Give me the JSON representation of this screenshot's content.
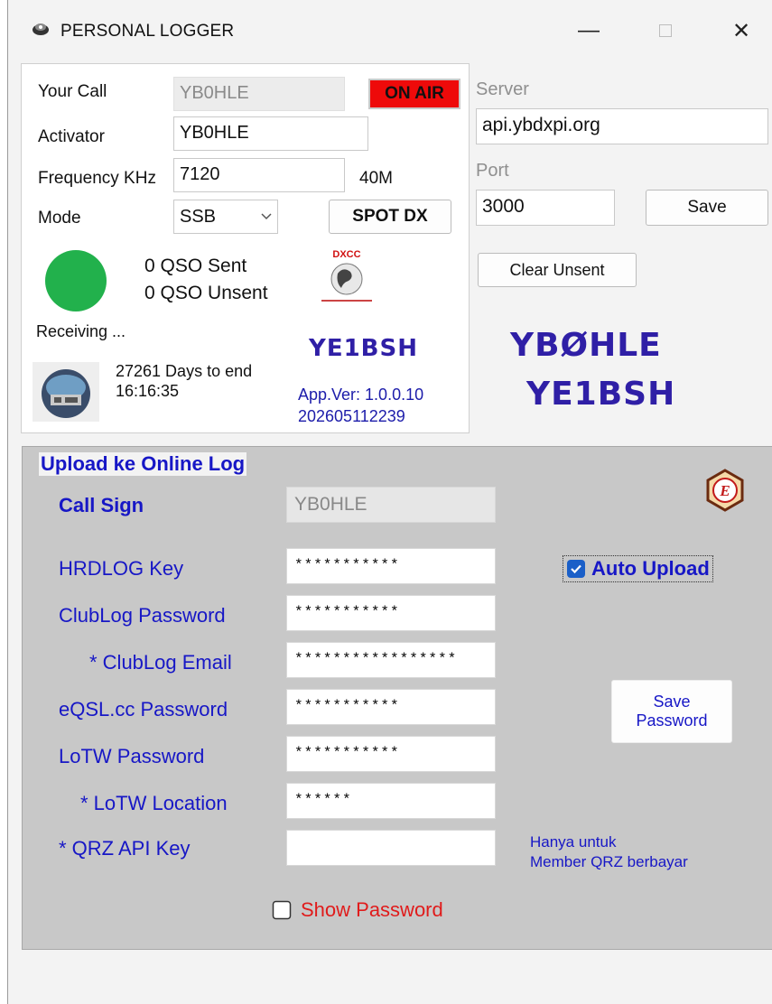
{
  "window": {
    "title": "PERSONAL LOGGER",
    "minimize": "—",
    "close": "✕"
  },
  "station": {
    "your_call_label": "Your Call",
    "your_call_value": "YB0HLE",
    "on_air": "ON AIR",
    "activator_label": "Activator",
    "activator_value": "YB0HLE",
    "frequency_label": "Frequency KHz",
    "frequency_value": "7120",
    "band": "40M",
    "mode_label": "Mode",
    "mode_value": "SSB",
    "spot_dx": "SPOT DX",
    "qso_sent": "0 QSO Sent",
    "qso_unsent": "0 QSO Unsent",
    "dxcc_logo_text": "DXCC",
    "status": "Receiving ...",
    "callsign_brand": "YE1BSH",
    "days_to_end": "27261 Days to end",
    "clock": "16:16:35",
    "app_version": "App.Ver: 1.0.0.10",
    "build": "202605112239"
  },
  "server": {
    "server_label": "Server",
    "server_value": "api.ybdxpi.org",
    "port_label": "Port",
    "port_value": "3000",
    "save": "Save",
    "clear_unsent": "Clear Unsent",
    "brand_line1": "YBØHLE",
    "brand_line2": "YE1BSH"
  },
  "upload": {
    "title": "Upload ke Online Log",
    "call_sign_label": "Call Sign",
    "call_sign_value": "YB0HLE",
    "hrdlog_label": "HRDLOG Key",
    "hrdlog_value": "***********",
    "clublog_pw_label": "ClubLog Password",
    "clublog_pw_value": "***********",
    "clublog_email_label": "* ClubLog Email",
    "clublog_email_value": "*****************",
    "eqsl_label": "eQSL.cc Password",
    "eqsl_value": "***********",
    "lotw_pw_label": "LoTW Password",
    "lotw_pw_value": "***********",
    "lotw_loc_label": "* LoTW Location",
    "lotw_loc_value": "******",
    "qrz_label": "* QRZ API Key",
    "qrz_value": "",
    "qrz_note_1": "Hanya untuk",
    "qrz_note_2": "Member QRZ berbayar",
    "auto_upload": "Auto Upload",
    "auto_upload_checked": true,
    "save_password_1": "Save",
    "save_password_2": "Password",
    "show_password": "Show Password",
    "show_password_checked": false
  },
  "colors": {
    "label_blue": "#1717c6",
    "brand_purple": "#2f1fa6",
    "on_air_red": "#ee0a0a",
    "led_green": "#22b14c",
    "show_password_red": "#e01b1b"
  }
}
